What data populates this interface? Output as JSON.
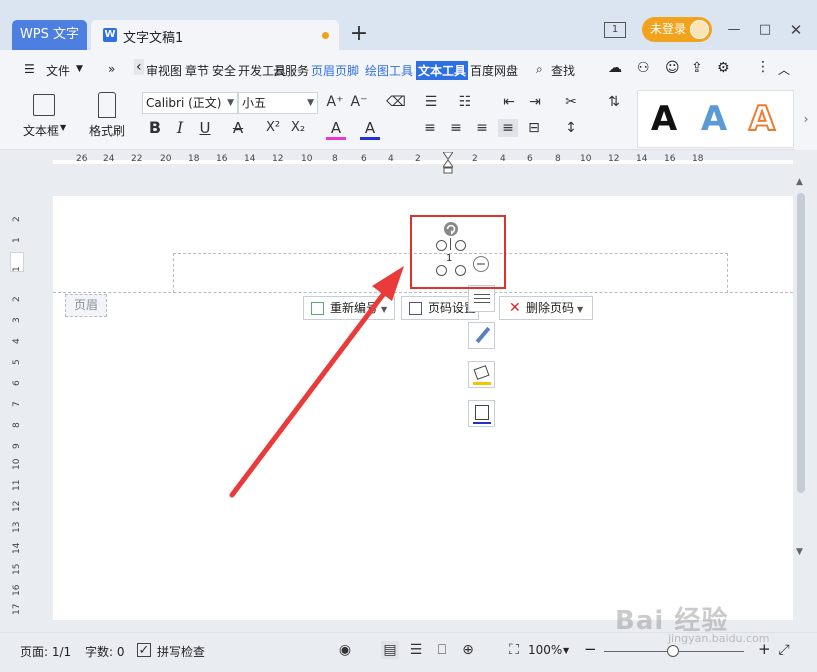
{
  "titlebar": {
    "app_tab": "WPS 文字",
    "doc_tab": "文字文稿1",
    "new_tab": "+",
    "login": "未登录",
    "icons": [
      "tablet-icon",
      "minimize-icon",
      "restore-icon",
      "close-icon"
    ]
  },
  "menubar": {
    "file": "文件",
    "more": "»",
    "back": "‹",
    "tabs": [
      "审视图",
      "章节",
      "安全",
      "开发工具",
      "云服务",
      "页眉页脚",
      "绘图工具",
      "文本工具",
      "百度网盘"
    ],
    "active_tab": "文本工具",
    "search": "查找"
  },
  "ribbon": {
    "textbox_label": "文本框",
    "format_painter_label": "格式刷",
    "font_name": "Calibri (正文)",
    "font_size": "小五",
    "bold": "B",
    "italic": "I",
    "underline": "U",
    "strike": "A",
    "superscript": "X²",
    "subscript": "X₂",
    "highlight": "A",
    "font_color": "A",
    "art_styles": [
      "A",
      "A",
      "A"
    ],
    "art_colors": [
      "#111111",
      "#5b9bd5",
      "#ed7d31"
    ]
  },
  "ruler": {
    "numbers": [
      "26",
      "24",
      "22",
      "20",
      "18",
      "16",
      "14",
      "12",
      "10",
      "8",
      "6",
      "4",
      "2",
      "2",
      "4",
      "6",
      "8",
      "10",
      "12",
      "14",
      "16",
      "18"
    ]
  },
  "vruler": {
    "numbers": [
      "2",
      "1",
      "1",
      "2",
      "3",
      "4",
      "5",
      "6",
      "7",
      "8",
      "9",
      "10",
      "11",
      "12",
      "13",
      "14",
      "15",
      "16",
      "17"
    ]
  },
  "page": {
    "header_tag": "页眉",
    "textbox_number": "1",
    "buttons": {
      "renumber": "重新编号",
      "page_setup": "页码设置",
      "delete": "删除页码"
    }
  },
  "statusbar": {
    "page": "页面: 1/1",
    "words": "字数: 0",
    "spell": "拼写检查",
    "zoom": "100%",
    "zoom_minus": "−",
    "zoom_plus": "+"
  },
  "watermark": {
    "main": "Bai 经验",
    "sub": "jingyan.baidu.com"
  }
}
